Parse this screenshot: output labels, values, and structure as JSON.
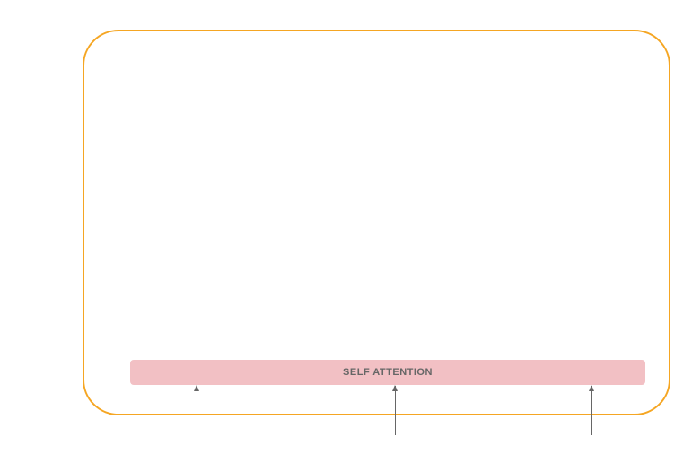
{
  "diagram": {
    "container_color": "#f5a623",
    "block": {
      "label": "SELF ATTENTION",
      "bg_color": "#f2c0c4",
      "text_color": "#666666"
    },
    "arrows": {
      "count": 3,
      "color": "#666666"
    }
  }
}
